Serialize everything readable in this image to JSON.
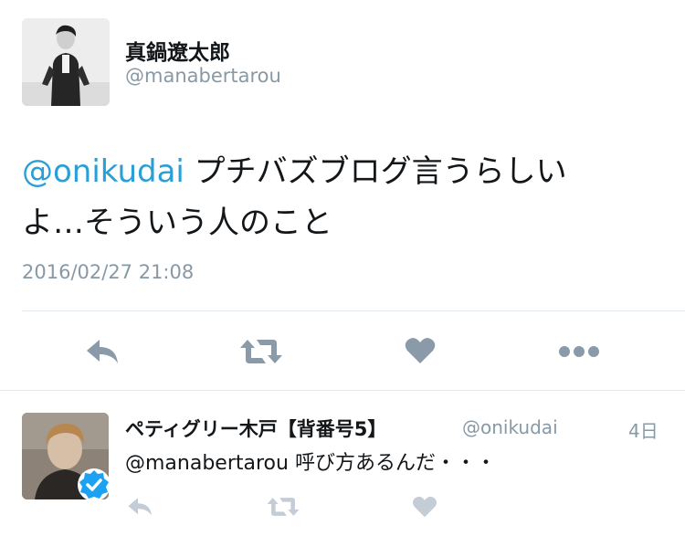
{
  "tweet": {
    "author": {
      "name": "真鍋遼太郎",
      "handle": "@manabertarou"
    },
    "mention": "@onikudai",
    "text_line1": " プチバズブログ言うらしい",
    "text_line2": "よ…そういう人のこと",
    "timestamp": "2016/02/27 21:08",
    "actions": [
      "reply-icon",
      "retweet-icon",
      "like-icon",
      "more-icon"
    ]
  },
  "reply": {
    "author": {
      "name": "ペティグリー木戸【背番号5】",
      "handle": "@onikudai",
      "verified": true
    },
    "time": "4日",
    "mention": "@manabertarou",
    "text": " 呼び方あるんだ・・・",
    "actions": [
      "reply-icon",
      "retweet-icon",
      "like-icon"
    ]
  },
  "colors": {
    "link": "#2a9fd6",
    "muted": "#8899a6",
    "icon": "#8a9aa8",
    "icon_faint": "#c4cdd5",
    "verified": "#1da1f2"
  }
}
